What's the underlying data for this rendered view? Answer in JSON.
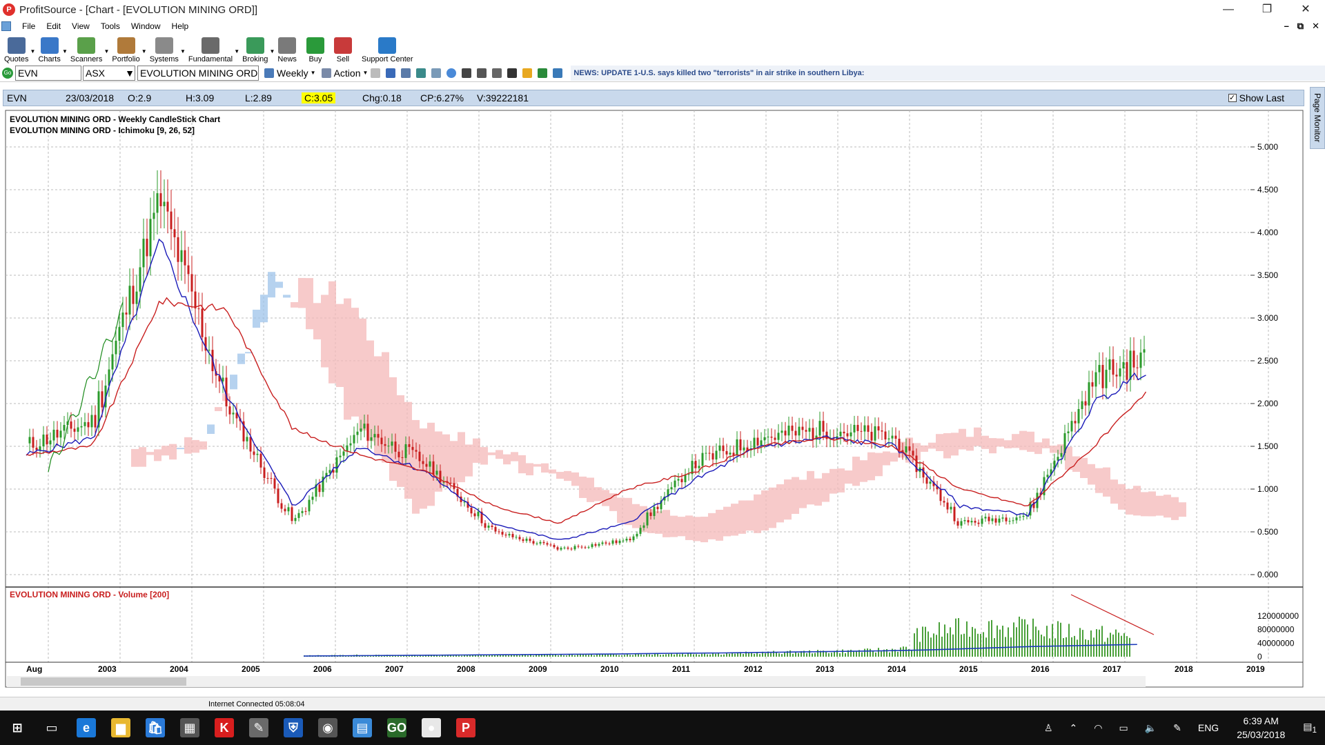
{
  "window": {
    "app_initial": "P",
    "title": "ProfitSource - [Chart - [EVOLUTION MINING ORD]]",
    "controls": [
      "—",
      "❐",
      "✕"
    ],
    "mdi_controls": [
      "–",
      "⧉",
      "✕"
    ]
  },
  "menu": [
    "File",
    "Edit",
    "View",
    "Tools",
    "Window",
    "Help"
  ],
  "toolbar": [
    {
      "label": "Quotes",
      "color": "#4a6a9a"
    },
    {
      "label": "Charts",
      "color": "#3a78c8"
    },
    {
      "label": "Scanners",
      "color": "#5aa04a"
    },
    {
      "label": "Portfolio",
      "color": "#b07a3a"
    },
    {
      "label": "Systems",
      "color": "#8a8a8a"
    },
    {
      "label": "Fundamental",
      "color": "#6a6a6a"
    },
    {
      "label": "Broking",
      "color": "#3a9a5a"
    },
    {
      "label": "News",
      "color": "#7a7a7a"
    },
    {
      "label": "Buy",
      "color": "#2a9a3a"
    },
    {
      "label": "Sell",
      "color": "#c83a3a"
    },
    {
      "label": "Support Center",
      "color": "#2a7ac8"
    }
  ],
  "symbol_bar": {
    "go": "Go",
    "symbol": "EVN",
    "exchange": "ASX",
    "name": "EVOLUTION MINING ORD",
    "period": "Weekly",
    "action": "Action",
    "news": "NEWS: UPDATE 1-U.S. says killed two \"terrorists\" in air strike in southern Libya:"
  },
  "info": {
    "symbol": "EVN",
    "date": "23/03/2018",
    "open": "O:2.9",
    "high": "H:3.09",
    "low": "L:2.89",
    "close": "C:3.05",
    "chg": "Chg:0.18",
    "cp": "CP:6.27%",
    "vol": "V:39222181",
    "show_last": "Show Last"
  },
  "page_monitor": "Page Monitor",
  "chart_data": {
    "type": "line",
    "title": "EVOLUTION MINING ORD - Weekly CandleStick Chart",
    "subtitle": "EVOLUTION MINING ORD - Ichimoku [9, 26, 52]",
    "volume_title": "EVOLUTION MINING ORD - Volume [200]",
    "x": [
      "Aug 2002",
      "2003",
      "2004",
      "2005",
      "2006",
      "2007",
      "2008",
      "2009",
      "2010",
      "2011",
      "2012",
      "2013",
      "2014",
      "2015",
      "2016",
      "2017",
      "2018"
    ],
    "x_ticks": [
      "Aug",
      "2003",
      "2004",
      "2005",
      "2006",
      "2007",
      "2008",
      "2009",
      "2010",
      "2011",
      "2012",
      "2013",
      "2014",
      "2015",
      "2016",
      "2017",
      "2018",
      "2019"
    ],
    "ylim": [
      0,
      5.2
    ],
    "y_ticks": [
      "0.000",
      "0.500",
      "1.000",
      "1.500",
      "2.000",
      "2.500",
      "3.000",
      "3.500",
      "4.000",
      "4.500",
      "5.000"
    ],
    "volume_ticks": [
      "0",
      "40000000",
      "80000000",
      "120000000"
    ],
    "volume_ylim": [
      0,
      150000000
    ],
    "series": [
      {
        "values": [
          1.5,
          1.8,
          4.4,
          2.0,
          0.6,
          1.7,
          1.3,
          0.5,
          0.3,
          0.4,
          1.3,
          1.6,
          1.7,
          1.6,
          0.6,
          0.7,
          2.3,
          2.6
        ]
      },
      {
        "values": [
          1.4,
          1.6,
          3.9,
          2.1,
          0.8,
          1.5,
          1.2,
          0.6,
          0.4,
          0.6,
          1.1,
          1.5,
          1.6,
          1.5,
          0.8,
          0.7,
          2.0,
          2.5
        ]
      },
      {
        "values": [
          1.4,
          1.5,
          3.2,
          3.1,
          1.7,
          1.4,
          1.2,
          0.8,
          0.6,
          1.0,
          1.2,
          1.5,
          1.6,
          1.5,
          1.0,
          0.8,
          1.5,
          2.3
        ]
      }
    ],
    "volume": [
      5,
      8,
      6,
      7,
      9,
      10,
      12,
      14,
      16,
      20,
      25,
      30,
      45,
      60,
      55,
      48,
      40
    ],
    "volume_ma": [
      2,
      3,
      4,
      5,
      6,
      7,
      8,
      10,
      11,
      13,
      15,
      17,
      20,
      25,
      30,
      33,
      36
    ],
    "grid": true,
    "colors": {
      "up": "#2a9a2a",
      "down": "#c81e1e",
      "tenkan": "#1a1ab8",
      "kijun": "#c81e1e",
      "chikou": "#1a8a1a",
      "cloud_bull": "#9ec3ea",
      "cloud_bear": "#f4b8b8",
      "volume": "#4aa03a",
      "volume_ma": "#1a3ab8"
    }
  },
  "status": "Internet Connected 05:08:04",
  "taskbar": {
    "apps": [
      {
        "name": "start",
        "glyph": "⊞",
        "bg": "transparent"
      },
      {
        "name": "task-view",
        "glyph": "▭",
        "bg": "transparent"
      },
      {
        "name": "edge",
        "glyph": "e",
        "bg": "#1a78d8"
      },
      {
        "name": "explorer",
        "glyph": "▆",
        "bg": "#e8b830"
      },
      {
        "name": "store",
        "glyph": "🛍",
        "bg": "#2a7ad8"
      },
      {
        "name": "calculator",
        "glyph": "▦",
        "bg": "#555555"
      },
      {
        "name": "k-app",
        "glyph": "K",
        "bg": "#d81e1e"
      },
      {
        "name": "paint-app",
        "glyph": "✎",
        "bg": "#6a6a6a"
      },
      {
        "name": "security",
        "glyph": "⛨",
        "bg": "#1a5ab8"
      },
      {
        "name": "camera",
        "glyph": "◉",
        "bg": "#555555"
      },
      {
        "name": "app-window",
        "glyph": "▤",
        "bg": "#3a8ad8"
      },
      {
        "name": "go-app",
        "glyph": "GO",
        "bg": "#2a6a2a"
      },
      {
        "name": "chrome",
        "glyph": "●",
        "bg": "#e8e8e8"
      },
      {
        "name": "profitsource",
        "glyph": "P",
        "bg": "#d82a2a"
      }
    ],
    "lang": "ENG",
    "time": "6:39 AM",
    "date": "25/03/2018",
    "notif": "1"
  }
}
